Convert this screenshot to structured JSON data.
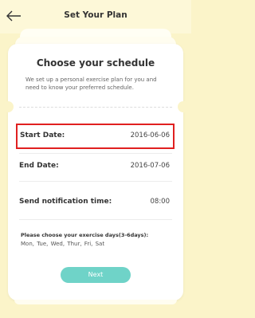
{
  "header": {
    "title": "Set Your Plan",
    "back_icon": "arrow-left-icon"
  },
  "card": {
    "heading": "Choose your schedule",
    "subtitle": "We set up a personal exercise plan for you and need to know your preferred schedule."
  },
  "rows": [
    {
      "label": "Start Date:",
      "value": "2016-06-06"
    },
    {
      "label": "End Date:",
      "value": "2016-07-06"
    },
    {
      "label": "Send notification time:",
      "value": "08:00"
    }
  ],
  "days": {
    "title": "Please choose your exercise days(3-6days):",
    "list": "Mon, Tue,  Wed,  Thur,  Fri,  Sat"
  },
  "next_label": "Next",
  "colors": {
    "background": "#fbf4c9",
    "accent": "#6fd3c8",
    "highlight": "#e02020"
  }
}
